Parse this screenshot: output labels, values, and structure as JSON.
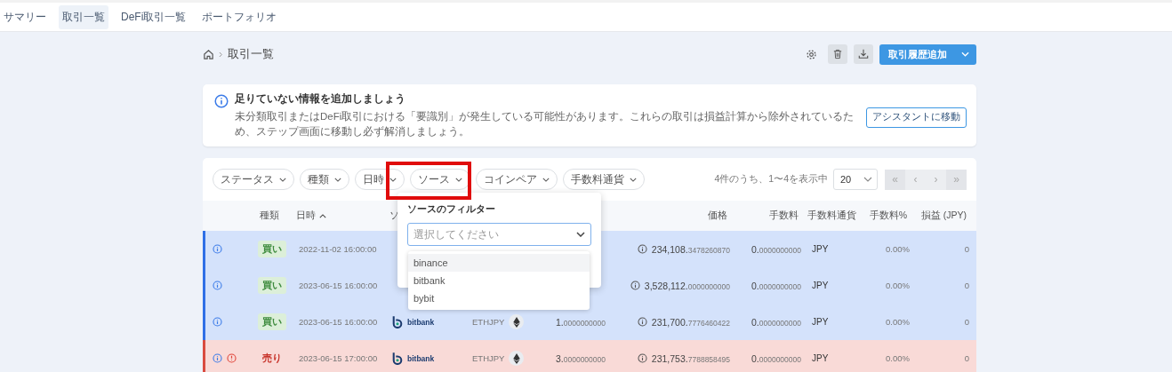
{
  "nav_tabs": [
    {
      "label": "サマリー",
      "selected": false
    },
    {
      "label": "取引一覧",
      "selected": true
    },
    {
      "label": "DeFi取引一覧",
      "selected": false
    },
    {
      "label": "ポートフォリオ",
      "selected": false
    }
  ],
  "breadcrumb": {
    "current": "取引一覧"
  },
  "toolbar": {
    "primary_button": "取引履歴追加"
  },
  "alert": {
    "title": "足りていない情報を追加しましょう",
    "message": "未分類取引またはDeFi取引における「要識別」が発生している可能性があります。これらの取引は損益計算から除外されているため、ステップ画面に移動し必ず解消しましょう。",
    "button": "アシスタントに移動"
  },
  "filters": [
    "ステータス",
    "種類",
    "日時",
    "ソース",
    "コインペア",
    "手数料通貨"
  ],
  "pagination": {
    "summary": "4件のうち、1〜4を表示中",
    "page_size": "20",
    "buttons": [
      "«",
      "‹",
      "›",
      "»"
    ]
  },
  "table": {
    "columns": [
      {},
      {
        "label": "種類"
      },
      {
        "label": "日時",
        "sort_ascending": true
      },
      {
        "label": "ソ"
      },
      {},
      {},
      {
        "label": "価格"
      },
      {
        "label": "手数料"
      },
      {
        "label": "手数料通貨"
      },
      {
        "label": "手数料%"
      },
      {
        "label": "損益 (JPY)"
      }
    ],
    "rows": [
      {
        "kind": "buy",
        "warning": false,
        "type": "買い",
        "date": "2022-11-02 16:00:00",
        "price": "234,108.3478260870",
        "fee": "0.0000000000",
        "fee_currency": "JPY",
        "fee_pct": "0.00%",
        "pnl": "0"
      },
      {
        "kind": "buy",
        "warning": false,
        "type": "買い",
        "date": "2023-06-15 16:00:00",
        "price": "3,528,112.0000000000",
        "fee": "0.0000000000",
        "fee_currency": "JPY",
        "fee_pct": "0.00%",
        "pnl": "0"
      },
      {
        "kind": "buy",
        "warning": false,
        "type": "買い",
        "date": "2023-06-15 16:00:00",
        "source": "bitbank",
        "pair": "ETHJPY",
        "amount": "1.0000000000",
        "price": "231,700.7776460422",
        "fee": "0.0000000000",
        "fee_currency": "JPY",
        "fee_pct": "0.00%",
        "pnl": "0"
      },
      {
        "kind": "sell",
        "warning": true,
        "type": "売り",
        "date": "2023-06-15 17:00:00",
        "source": "bitbank",
        "pair": "ETHJPY",
        "amount": "3.0000000000",
        "price": "231,753.7788858495",
        "fee": "0.0000000000",
        "fee_currency": "JPY",
        "fee_pct": "0.00%",
        "pnl": "0"
      }
    ]
  },
  "source_filter": {
    "title": "ソースのフィルター",
    "placeholder": "選択してください",
    "options": [
      {
        "label": "binance",
        "selected": true
      },
      {
        "label": "bitbank",
        "selected": false
      },
      {
        "label": "bybit",
        "selected": false
      }
    ]
  },
  "highlight": {
    "shown": true
  }
}
